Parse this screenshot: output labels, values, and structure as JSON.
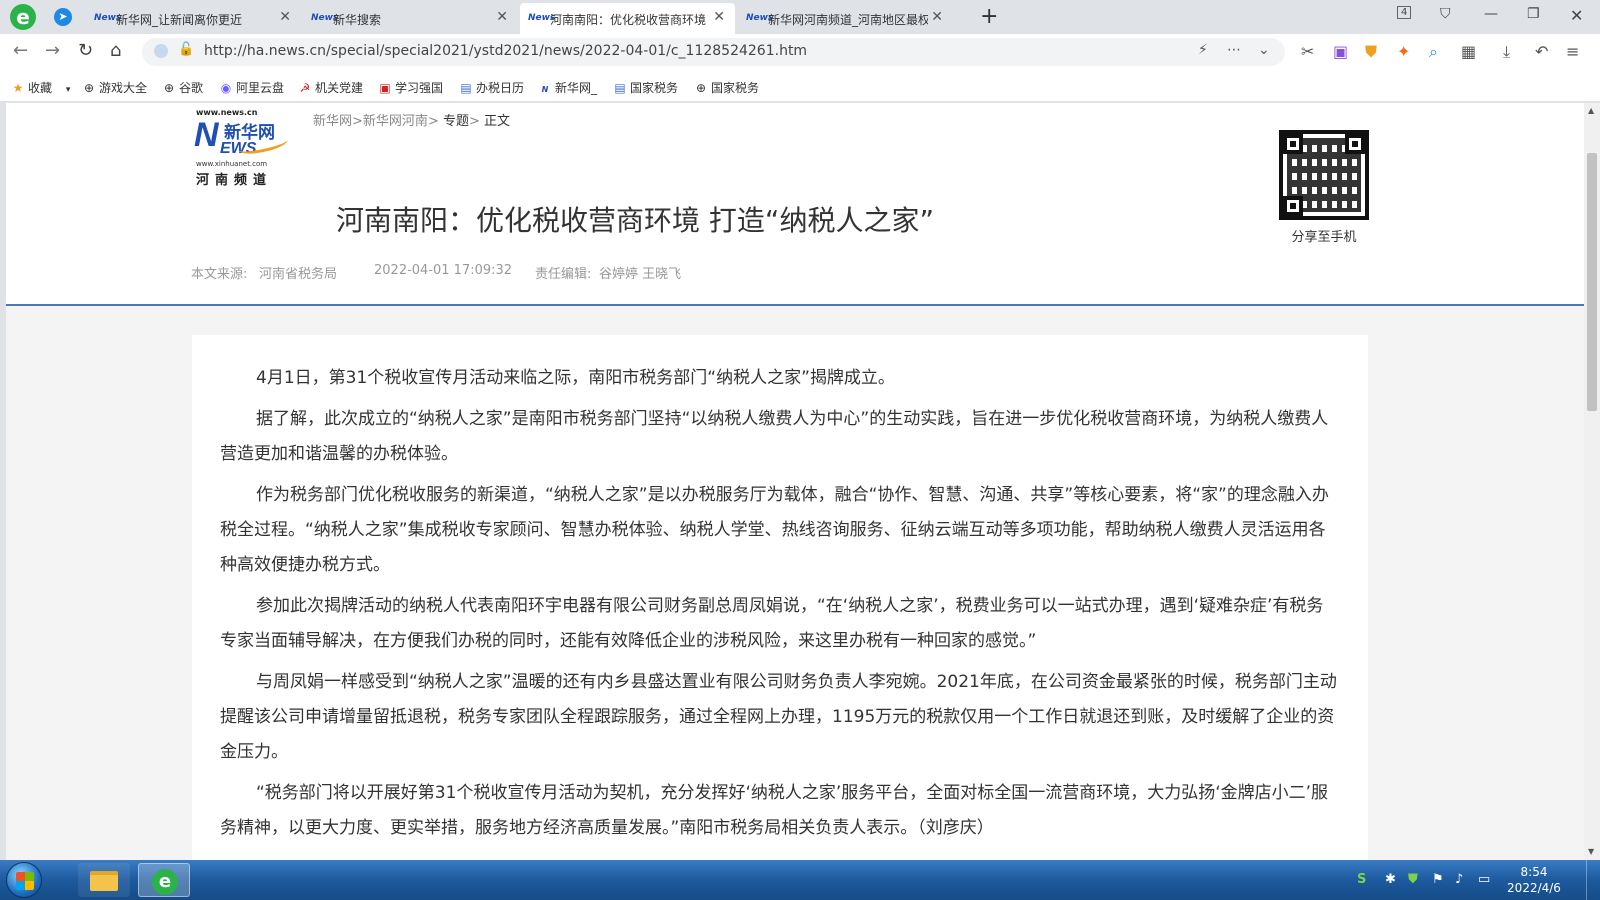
{
  "browser": {
    "tabs": [
      {
        "favicon": "News",
        "title": "新华网_让新闻离你更近"
      },
      {
        "favicon": "News",
        "title": "新华搜索"
      },
      {
        "favicon": "News",
        "title": "河南南阳：优化税收营商环境"
      },
      {
        "favicon": "News",
        "title": "新华网河南频道_河南地区最权"
      }
    ],
    "tab_count": "4",
    "url": "http://ha.news.cn/special/special2021/ystd2021/news/2022-04-01/c_1128524261.htm",
    "bookmarks": [
      {
        "icon": "star-icon",
        "label": "收藏"
      },
      {
        "icon": "globe-icon",
        "label": "游戏大全"
      },
      {
        "icon": "globe-icon",
        "label": "谷歌"
      },
      {
        "icon": "aliyun-icon",
        "label": "阿里云盘"
      },
      {
        "icon": "party-icon",
        "label": "机关党建"
      },
      {
        "icon": "xuexi-icon",
        "label": "学习强国"
      },
      {
        "icon": "calendar-icon",
        "label": "办税日历"
      },
      {
        "icon": "news-icon",
        "label": "新华网_"
      },
      {
        "icon": "tax-icon",
        "label": "国家税务"
      },
      {
        "icon": "globe-icon",
        "label": "国家税务"
      }
    ]
  },
  "site": {
    "logo": {
      "url_top": "www.news.cn",
      "letter": "N",
      "brand": "新华网",
      "ews": "EWS",
      "url_bottom": "www.xinhuanet.com",
      "channel": "河南频道"
    },
    "breadcrumb": {
      "home": "新华网",
      "sep1": ">",
      "section": "新华网河南",
      "sep2": ">",
      "topic": "专题",
      "sep3": ">",
      "current": "正文"
    },
    "qr_label": "分享至手机"
  },
  "article": {
    "title": "河南南阳：优化税收营商环境 打造“纳税人之家”",
    "source_label": "本文来源:",
    "source": "河南省税务局",
    "datetime": "2022-04-01 17:09:32",
    "editor_label": "责任编辑:",
    "editors": "谷婷婷 王晓飞",
    "paragraphs": [
      "4月1日，第31个税收宣传月活动来临之际，南阳市税务部门“纳税人之家”揭牌成立。",
      "据了解，此次成立的“纳税人之家”是南阳市税务部门坚持“以纳税人缴费人为中心”的生动实践，旨在进一步优化税收营商环境，为纳税人缴费人营造更加和谐温馨的办税体验。",
      "作为税务部门优化税收服务的新渠道，“纳税人之家”是以办税服务厅为载体，融合“协作、智慧、沟通、共享”等核心要素，将“家”的理念融入办税全过程。“纳税人之家”集成税收专家顾问、智慧办税体验、纳税人学堂、热线咨询服务、征纳云端互动等多项功能，帮助纳税人缴费人灵活运用各种高效便捷办税方式。",
      "参加此次揭牌活动的纳税人代表南阳环宇电器有限公司财务副总周凤娟说，“在‘纳税人之家’，税费业务可以一站式办理，遇到‘疑难杂症’有税务专家当面辅导解决，在方便我们办税的同时，还能有效降低企业的涉税风险，来这里办税有一种回家的感觉。”",
      "与周凤娟一样感受到“纳税人之家”温暖的还有内乡县盛达置业有限公司财务负责人李宛婉。2021年底，在公司资金最紧张的时候，税务部门主动提醒该公司申请增量留抵退税，税务专家团队全程跟踪服务，通过全程网上办理，1195万元的税款仅用一个工作日就退还到账，及时缓解了企业的资金压力。",
      "“税务部门将以开展好第31个税收宣传月活动为契机，充分发挥好‘纳税人之家’服务平台，全面对标全国一流营商环境，大力弘扬‘金牌店小二’服务精神，以更大力度、更实举措，服务地方经济高质量发展。”南阳市税务局相关负责人表示。（刘彦庆）"
    ]
  },
  "taskbar": {
    "time": "8:54",
    "date": "2022/4/6"
  },
  "colors": {
    "accent_blue": "#1f4fb3",
    "rule_blue": "#4a78b5",
    "taskbar": "#1d5a9e"
  }
}
